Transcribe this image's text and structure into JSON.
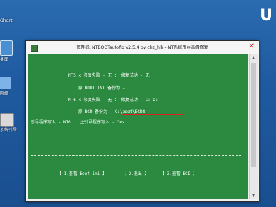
{
  "desktop": {
    "icons": [
      {
        "label": "Ghost"
      },
      {
        "label": "桌面"
      },
      {
        "label": "网络"
      },
      {
        "label": "系统引导"
      }
    ],
    "logo": "U"
  },
  "window": {
    "title": "管理员:  NTBOOTautofix v2.5.4 by chz_hlh - NT系统引导高级修复",
    "close_glyph": "✕"
  },
  "console": {
    "nt5_line": "NT5.x 修复失败 - 无 ：    修复成功 - 无",
    "nt5_backup": "原 BOOT.INI 备份为 -",
    "nt6_line": "NT6.x 修复失败 - 无 ：    修复成功 - C: D:",
    "nt6_backup": "原 BCD 备份为 - C:\\boot\\BCD8",
    "loader_line": "引导程序写入 - NT6    ：   主引导程序写入 - Yes",
    "btn_view_bootini": "【 1.查看 Boot.ini 】",
    "btn_exit": "【 2.退出 】",
    "btn_view_bcd": "【   3.查看  BCD   】"
  },
  "scrollbar": {
    "up": "▲",
    "down": "▼"
  }
}
